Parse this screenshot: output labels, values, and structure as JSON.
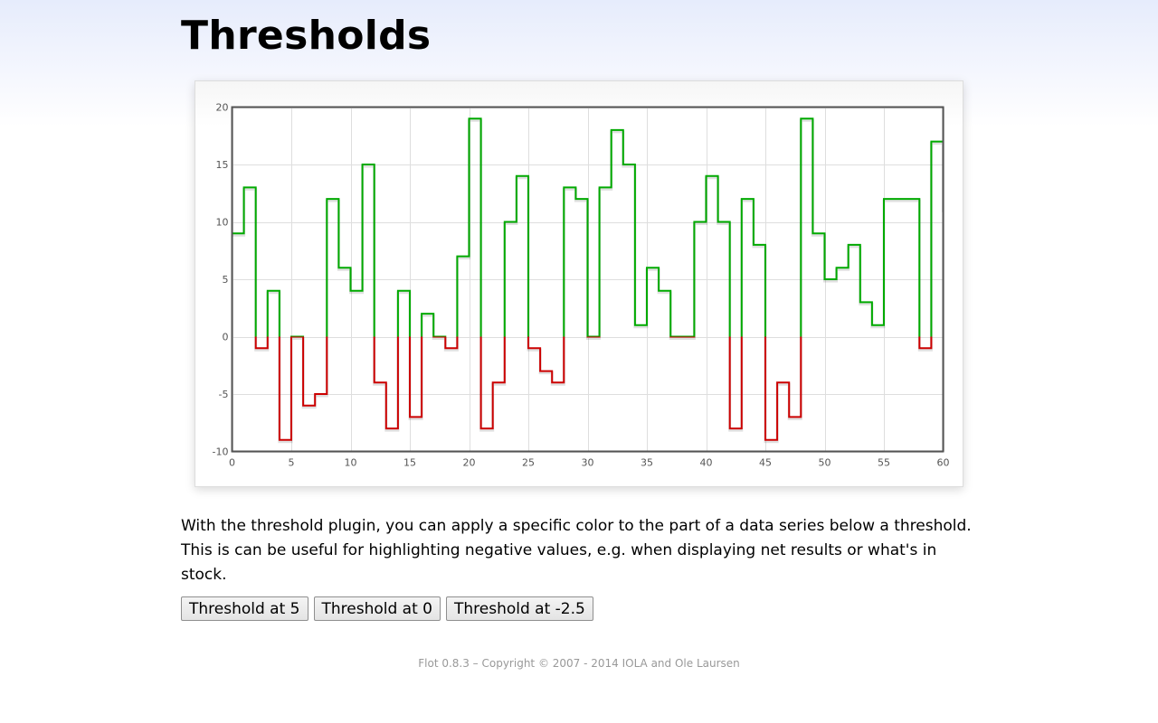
{
  "page": {
    "title": "Thresholds",
    "description": "With the threshold plugin, you can apply a specific color to the part of a data series below a threshold. This is can be useful for highlighting negative values, e.g. when displaying net results or what's in stock.",
    "buttons": [
      "Threshold at 5",
      "Threshold at 0",
      "Threshold at -2.5"
    ],
    "footer": "Flot 0.8.3 – Copyright © 2007 - 2014 IOLA and Ole Laursen"
  },
  "chart_data": {
    "type": "line",
    "step": true,
    "title": "",
    "xlabel": "",
    "ylabel": "",
    "xlim": [
      0,
      60
    ],
    "ylim": [
      -10,
      20
    ],
    "xticks": [
      0,
      5,
      10,
      15,
      20,
      25,
      30,
      35,
      40,
      45,
      50,
      55,
      60
    ],
    "yticks": [
      -10,
      -5,
      0,
      5,
      10,
      15,
      20
    ],
    "grid": true,
    "threshold": {
      "below": 0,
      "color": "#cc0000"
    },
    "series": [
      {
        "color": "#00aa00",
        "x": [
          0,
          1,
          2,
          3,
          4,
          5,
          6,
          7,
          8,
          9,
          10,
          11,
          12,
          13,
          14,
          15,
          16,
          17,
          18,
          19,
          20,
          21,
          22,
          23,
          24,
          25,
          26,
          27,
          28,
          29,
          30,
          31,
          32,
          33,
          34,
          35,
          36,
          37,
          38,
          39,
          40,
          41,
          42,
          43,
          44,
          45,
          46,
          47,
          48,
          49,
          50,
          51,
          52,
          53,
          54,
          55,
          56,
          57,
          58,
          59,
          60
        ],
        "y": [
          9,
          13,
          -1,
          4,
          -9,
          0,
          -6,
          -5,
          12,
          6,
          4,
          15,
          -4,
          -8,
          4,
          -7,
          2,
          0,
          -1,
          7,
          19,
          -8,
          -4,
          10,
          14,
          -1,
          -3,
          -4,
          13,
          12,
          0,
          13,
          18,
          15,
          1,
          6,
          4,
          0,
          0,
          10,
          14,
          10,
          -8,
          12,
          8,
          -9,
          -4,
          -7,
          19,
          9,
          5,
          6,
          8,
          3,
          1,
          12,
          12,
          12,
          -1,
          17,
          11
        ]
      }
    ]
  }
}
